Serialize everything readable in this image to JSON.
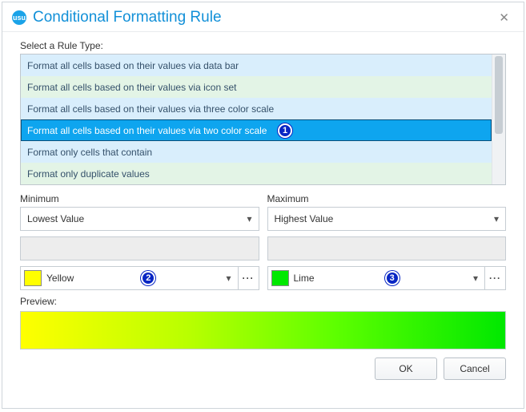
{
  "header": {
    "app_icon_text": "usu",
    "title": "Conditional Formatting Rule"
  },
  "rule_type": {
    "label": "Select a Rule Type:",
    "items": [
      "Format all cells based on their values via data bar",
      "Format all cells based on their values via icon set",
      "Format all cells based on their values via three color scale",
      "Format all cells based on their values via two color scale",
      "Format only cells that contain",
      "Format only duplicate values"
    ]
  },
  "minimum": {
    "label": "Minimum",
    "type_selected": "Lowest Value",
    "color_name": "Yellow",
    "color_hex": "#ffff00"
  },
  "maximum": {
    "label": "Maximum",
    "type_selected": "Highest Value",
    "color_name": "Lime",
    "color_hex": "#00e800"
  },
  "preview": {
    "label": "Preview:"
  },
  "callouts": {
    "c1": "1",
    "c2": "2",
    "c3": "3"
  },
  "footer": {
    "ok": "OK",
    "cancel": "Cancel"
  },
  "glyphs": {
    "chevron_down": "▾",
    "close": "✕",
    "ellipsis": "···"
  }
}
